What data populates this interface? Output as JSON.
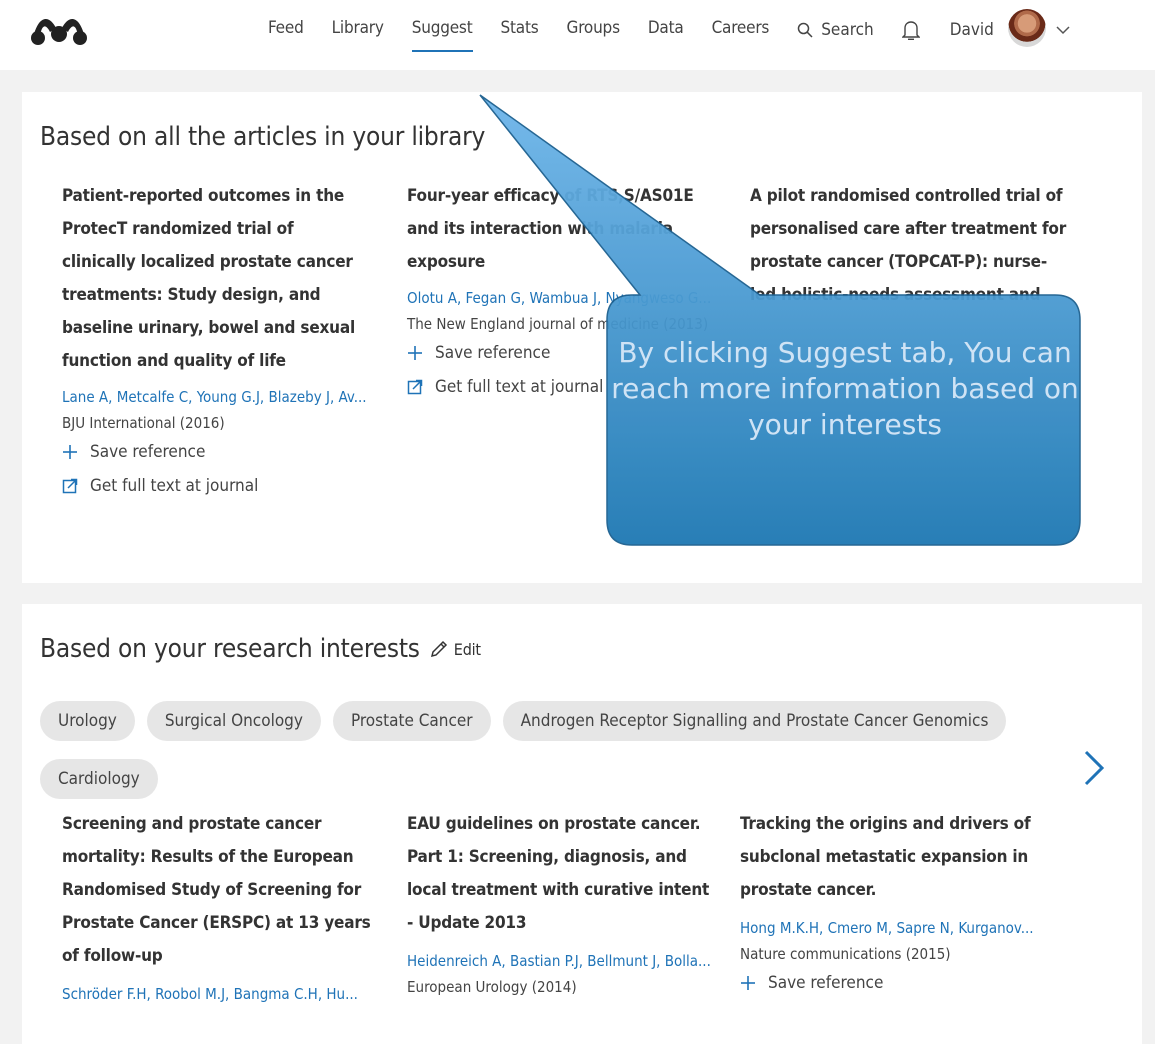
{
  "nav": {
    "items": [
      "Feed",
      "Library",
      "Suggest",
      "Stats",
      "Groups",
      "Data",
      "Careers"
    ],
    "active": "Suggest",
    "search_label": "Search",
    "user_name": "David"
  },
  "section1": {
    "title": "Based on all the articles in your library",
    "articles": [
      {
        "title": "Patient-reported outcomes in the ProtecT randomized trial of clinically localized prostate cancer treatments: Study design, and baseline urinary, bowel and sexual function and quality of life",
        "authors": "Lane A, Metcalfe C, Young G.J, Blazeby J, Av...",
        "journal": "BJU International (2016)",
        "save": "Save reference",
        "fulltext": "Get full text at journal"
      },
      {
        "title": "Four-year efficacy of RTS,S/AS01E and its interaction with malaria exposure",
        "authors": "Olotu A, Fegan G, Wambua J, Nyangweso G...",
        "journal": "The New England journal of medicine (2013)",
        "save": "Save reference",
        "fulltext": "Get full text at journal"
      },
      {
        "title": "A pilot randomised controlled trial of personalised care after treatment for prostate cancer (TOPCAT-P): nurse-led holistic-needs assessment and",
        "authors": "",
        "journal": "",
        "save": "",
        "fulltext": ""
      }
    ]
  },
  "section2": {
    "title": "Based on your research interests",
    "edit_label": "Edit",
    "tags": [
      "Urology",
      "Surgical Oncology",
      "Prostate Cancer",
      "Androgen Receptor Signalling and Prostate Cancer Genomics",
      "Cardiology"
    ],
    "articles": [
      {
        "title": "Screening and prostate cancer mortality: Results of the European Randomised Study of Screening for Prostate Cancer (ERSPC) at 13 years of follow-up",
        "authors": "Schröder F.H, Roobol M.J, Bangma C.H, Hu...",
        "journal": "",
        "save": ""
      },
      {
        "title": "EAU guidelines on prostate cancer. Part 1: Screening, diagnosis, and local treatment with curative intent - Update 2013",
        "authors": "Heidenreich A, Bastian P.J, Bellmunt J, Bolla...",
        "journal": "European Urology (2014)",
        "save": ""
      },
      {
        "title": "Tracking the origins and drivers of subclonal metastatic expansion in prostate cancer.",
        "authors": "Hong M.K.H, Cmero M, Sapre N, Kurganov...",
        "journal": "Nature communications (2015)",
        "save": "Save reference"
      }
    ]
  },
  "callout": {
    "text": "By clicking Suggest tab, You can reach more information based on your interests",
    "fill": "#2a8bc6",
    "stroke": "#1b5f8f"
  }
}
